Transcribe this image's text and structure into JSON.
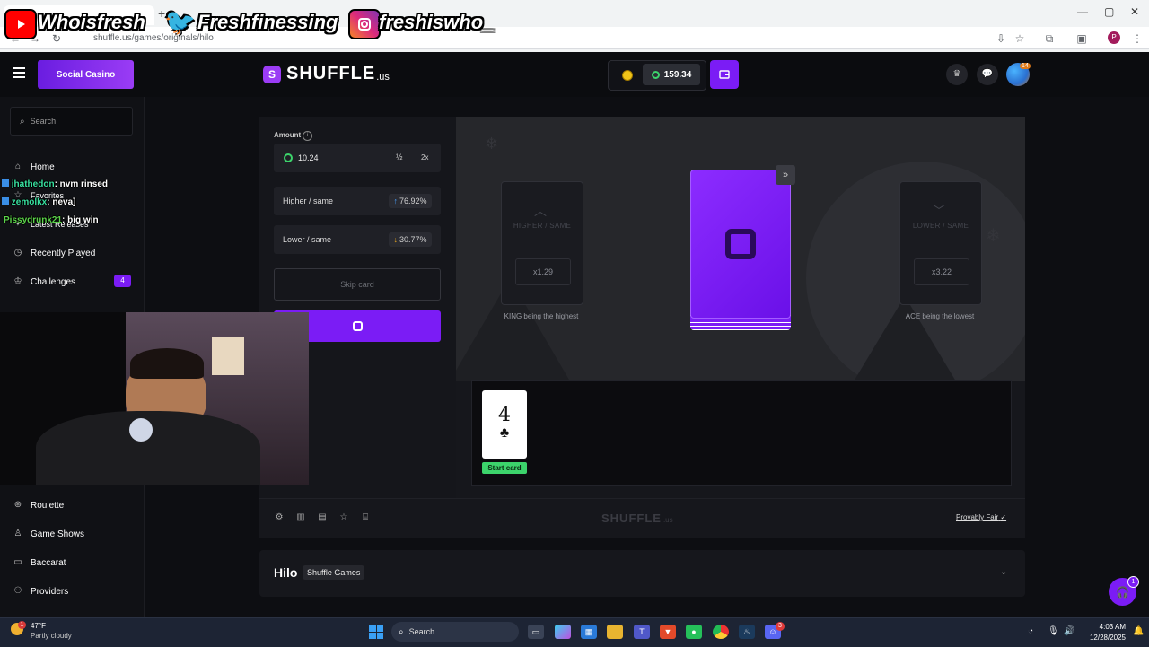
{
  "browser": {
    "url": "shuffle.us/games/originals/hilo",
    "window_controls": [
      "—",
      "▢",
      "✕"
    ]
  },
  "overlay": {
    "youtube_handle": "Whoisfresh",
    "twitter_handle": "Freshfinessing",
    "instagram_handle": "freshiswho_"
  },
  "site": {
    "logo_text": "SHUFFLE",
    "logo_suffix": ".us",
    "social_casino_label": "Social Casino",
    "balance": "159.34",
    "notification_count": "14"
  },
  "sidebar": {
    "search_placeholder": "Search",
    "items": [
      {
        "label": "Home",
        "icon": "home-icon"
      },
      {
        "label": "Favorites",
        "icon": "star-icon"
      },
      {
        "label": "Latest Releases",
        "icon": "new-icon"
      },
      {
        "label": "Recently Played",
        "icon": "history-icon"
      },
      {
        "label": "Challenges",
        "icon": "trophy-icon",
        "badge": "4"
      },
      {
        "label": "Roulette",
        "icon": "roulette-icon"
      },
      {
        "label": "Game Shows",
        "icon": "gameshow-icon"
      },
      {
        "label": "Baccarat",
        "icon": "cards-icon"
      },
      {
        "label": "Providers",
        "icon": "providers-icon"
      }
    ]
  },
  "chat": [
    {
      "user": "jhathedon",
      "message": ": nvm rinsed"
    },
    {
      "user": "zemolkx",
      "message": ": neva]"
    },
    {
      "user": "Pissydrunk21",
      "message": ": big win"
    }
  ],
  "controls": {
    "amount_label": "Amount",
    "amount_value": "10.24",
    "half_label": "½",
    "double_label": "2x",
    "higher_label": "Higher / same",
    "higher_pct": "76.92%",
    "lower_label": "Lower / same",
    "lower_pct": "30.77%",
    "skip_label": "Skip card"
  },
  "board": {
    "left_card_label": "HIGHER / SAME",
    "left_multiplier": "x1.29",
    "left_caption": "KING being the highest",
    "right_card_label": "LOWER / SAME",
    "right_multiplier": "x3.22",
    "right_caption": "ACE being the lowest"
  },
  "history": {
    "card_rank": "4",
    "card_suit": "♣",
    "start_label": "Start card"
  },
  "footer": {
    "logo_text": "SHUFFLE",
    "logo_suffix": ".us",
    "provably_fair": "Provably Fair"
  },
  "info": {
    "title": "Hilo",
    "tag": "Shuffle Games"
  },
  "taskbar": {
    "weather_temp": "47°F",
    "weather_desc": "Partly cloudy",
    "weather_badge": "1",
    "search_placeholder": "Search",
    "time": "4:03 AM",
    "date": "12/28/2025",
    "discord_badge": "3"
  },
  "support_badge": "1",
  "colors": {
    "accent_purple": "#7b1cf5",
    "up_blue": "#4aa3ff",
    "down_gold": "#e0a020",
    "start_green": "#3cd36b"
  }
}
